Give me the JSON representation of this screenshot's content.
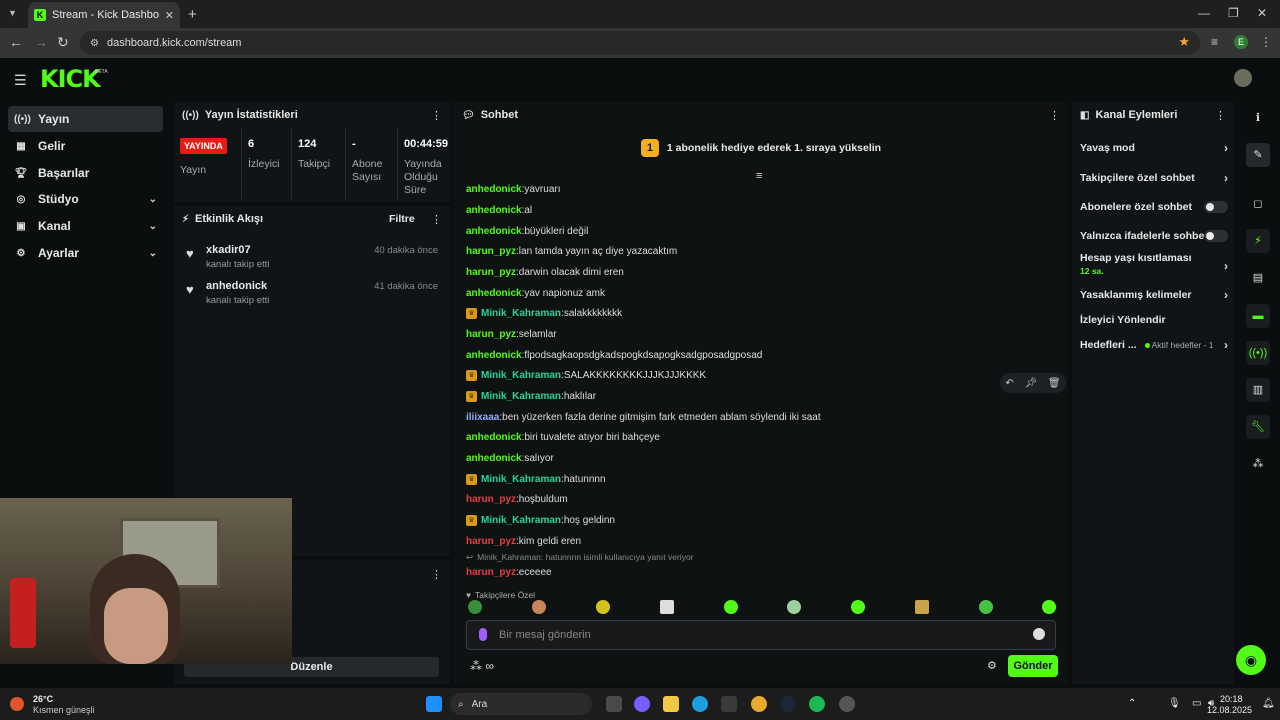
{
  "browser": {
    "tab_title": "Stream - Kick Dashboard",
    "url": "dashboard.kick.com/stream",
    "profile_letter": "E"
  },
  "app": {
    "logo": "KICK",
    "logo_badge": "BETA"
  },
  "sidebar": {
    "items": [
      {
        "label": "Yayın",
        "icon": "broadcast-icon"
      },
      {
        "label": "Gelir",
        "icon": "revenue-icon"
      },
      {
        "label": "Başarılar",
        "icon": "trophy-icon"
      },
      {
        "label": "Stüdyo",
        "icon": "studio-icon"
      },
      {
        "label": "Kanal",
        "icon": "channel-icon"
      },
      {
        "label": "Ayarlar",
        "icon": "gear-icon"
      }
    ]
  },
  "stats": {
    "title": "Yayın İstatistikleri",
    "live_badge": "YAYINDA",
    "live_label": "Yayın",
    "viewers_value": "6",
    "viewers_label": "İzleyici",
    "followers_value": "124",
    "followers_label": "Takipçi",
    "subs_value": "-",
    "subs_label": "Abone Sayısı",
    "uptime_value": "00:44:59",
    "uptime_label": "Yayında Olduğu Süre"
  },
  "activity": {
    "title": "Etkinlik Akışı",
    "filter_label": "Filtre",
    "rows": [
      {
        "name": "xkadir07",
        "action": "kanalı takip etti",
        "time": "40 dakika önce"
      },
      {
        "name": "anhedonick",
        "action": "kanalı takip etti",
        "time": "41 dakika önce"
      }
    ]
  },
  "edit_button": "Düzenle",
  "chat": {
    "title": "Sohbet",
    "gift_number": "1",
    "gift_text": "1 abonelik hediye ederek 1. sıraya yükselin",
    "lines": [
      {
        "user": "anhedonick",
        "msg": "yavruarı"
      },
      {
        "user": "anhedonick",
        "msg": "al"
      },
      {
        "user": "anhedonick",
        "msg": "büyükleri değil"
      },
      {
        "user": "harun_pyz",
        "msg": "lan tamda yayın aç diye yazacaktım"
      },
      {
        "user": "harun_pyz",
        "msg": "darwin olacak dimi eren"
      },
      {
        "user": "anhedonick",
        "msg": "yav napionuz amk"
      },
      {
        "user": "Minik_Kahraman",
        "msg": "salakkkkkkkk"
      },
      {
        "user": "harun_pyz",
        "msg": "selamlar"
      },
      {
        "user": "anhedonick",
        "msg": "flpodsagkaopsdgkadspogkdsapogksadgposadgposad"
      },
      {
        "user": "Minik_Kahraman",
        "msg": "SALAKKKKKKKKJJJKJJJKKKK"
      },
      {
        "user": "Minik_Kahraman",
        "msg": "haklılar"
      },
      {
        "user": "iliixaaa",
        "msg": "ben yüzerken fazla derine gitmişim fark etmeden ablam söylendi iki saat"
      },
      {
        "user": "anhedonick",
        "msg": "biri tuvalete atıyor biri bahçeye"
      },
      {
        "user": "anhedonick",
        "msg": "salıyor"
      },
      {
        "user": "Minik_Kahraman",
        "msg": "hatunnnn"
      },
      {
        "user": "harun_pyz",
        "msg": "hoşbuldum"
      },
      {
        "user": "Minik_Kahraman",
        "msg": "hoş geldinn"
      },
      {
        "user": "harun_pyz",
        "msg": "kim geldi eren"
      }
    ],
    "reply_hint": "Minik_Kahraman: hatunnnn isimli kullanıcıya yanıt veriyor",
    "last_line": {
      "user": "harun_pyz",
      "msg": "eceeee"
    },
    "followers_only": "Takipçilere Özel",
    "input_placeholder": "Bir mesaj gönderin",
    "send_label": "Gönder"
  },
  "channel_actions": {
    "title": "Kanal Eylemleri",
    "items": [
      {
        "label": "Yavaş mod"
      },
      {
        "label": "Takipçilere özel sohbet"
      },
      {
        "label": "Abonelere özel sohbet"
      },
      {
        "label": "Yalnızca ifadelerle sohbet"
      },
      {
        "label": "Hesap yaşı kısıtlaması",
        "sub": "12 sa."
      },
      {
        "label": "Yasaklanmış kelimeler"
      },
      {
        "label": "İzleyici Yönlendir"
      },
      {
        "label": "Hedefleri ...",
        "sub": "Aktif hedefler - 1"
      }
    ]
  },
  "taskbar": {
    "weather_temp": "26°C",
    "weather_desc": "Kısmen güneşli",
    "search_label": "Ara",
    "time": "20:18",
    "date": "12.08.2025"
  },
  "colors": {
    "accent": "#53fc18",
    "live": "#e91916",
    "gift": "#f2b01e"
  }
}
